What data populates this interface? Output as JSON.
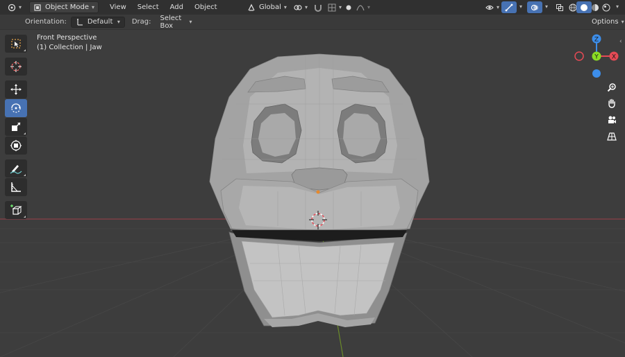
{
  "header": {
    "mode_label": "Object Mode",
    "menus": [
      "View",
      "Select",
      "Add",
      "Object"
    ],
    "transform_orientation": "Global"
  },
  "tool_settings": {
    "orientation_label": "Orientation:",
    "orientation_value": "Default",
    "drag_label": "Drag:",
    "drag_value": "Select Box",
    "options_label": "Options"
  },
  "viewport": {
    "view_name": "Front Perspective",
    "collection_info": "(1) Collection | Jaw"
  },
  "gizmo": {
    "x_label": "X",
    "y_label": "Y",
    "z_label": "Z",
    "colors": {
      "x": "#e64a55",
      "y": "#8bdc24",
      "z": "#3d8eea"
    }
  },
  "tools": [
    {
      "name": "select-box-tool",
      "icon": "select-box-icon",
      "active": false
    },
    {
      "name": "cursor-tool",
      "icon": "cursor-icon",
      "active": false
    },
    {
      "name": "move-tool",
      "icon": "move-icon",
      "active": false
    },
    {
      "name": "rotate-tool",
      "icon": "rotate-icon",
      "active": true
    },
    {
      "name": "scale-tool",
      "icon": "scale-icon",
      "active": false
    },
    {
      "name": "transform-tool",
      "icon": "transform-icon",
      "active": false
    },
    {
      "name": "annotate-tool",
      "icon": "annotate-icon",
      "active": false
    },
    {
      "name": "measure-tool",
      "icon": "measure-icon",
      "active": false
    },
    {
      "name": "add-cube-tool",
      "icon": "add-cube-icon",
      "active": false
    }
  ],
  "colors": {
    "accent": "#4772b3",
    "header_bg": "#303030",
    "viewport_bg": "#3d3d3d",
    "mesh": "#a8a8a8"
  }
}
